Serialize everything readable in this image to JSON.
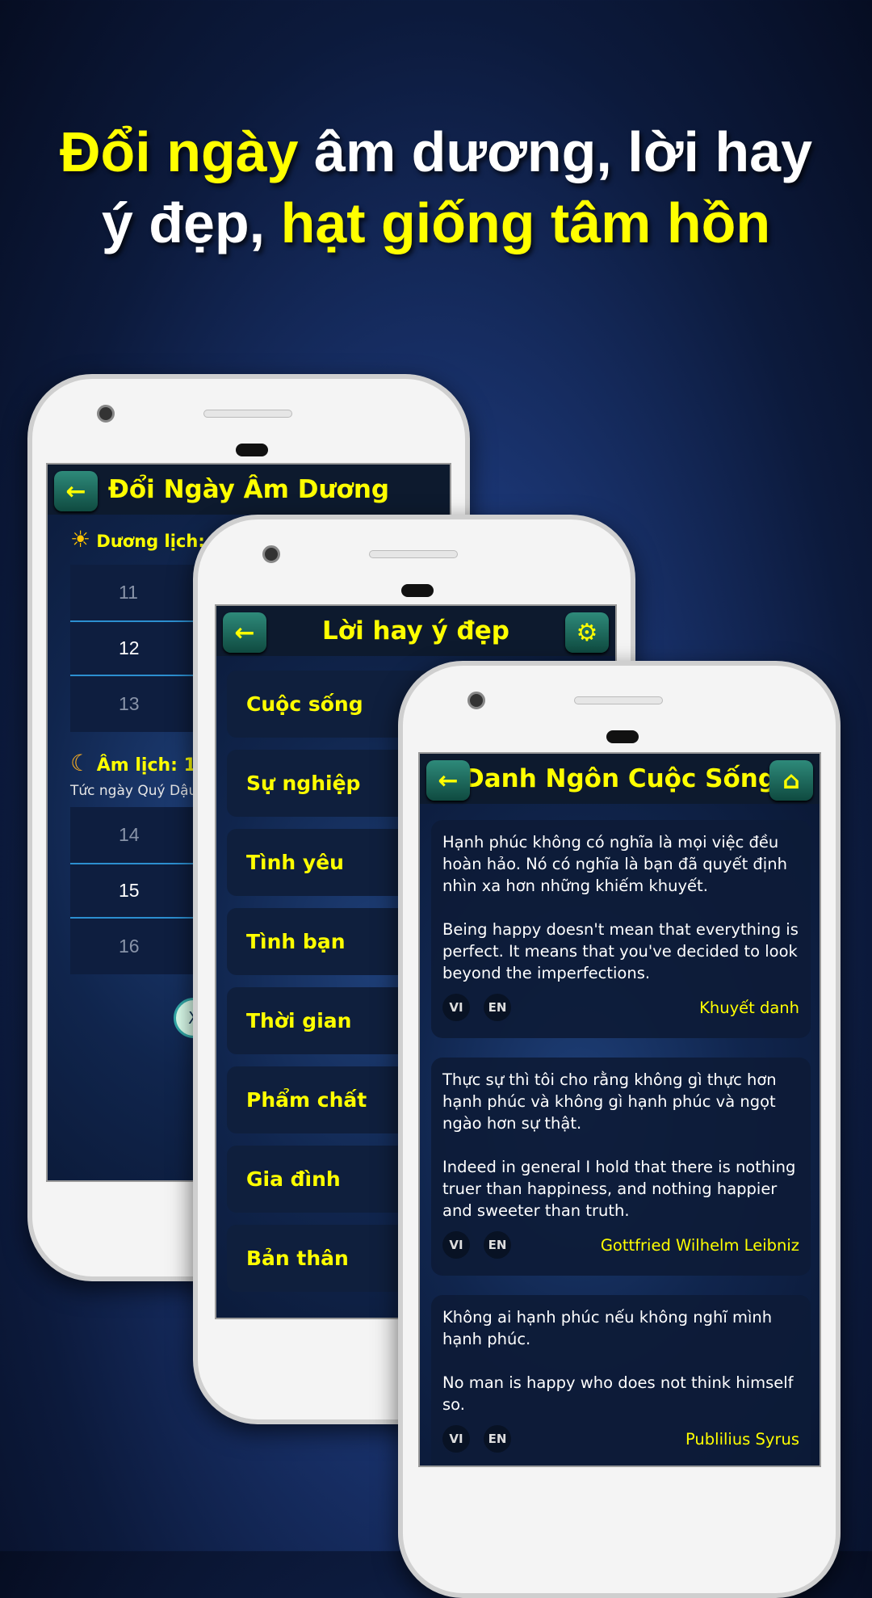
{
  "headline": {
    "line1_a": "Đổi ngày",
    "line1_b": " âm dương, lời hay",
    "line2_a": "ý đẹp, ",
    "line2_b": "hạt giống tâm hồn"
  },
  "colors": {
    "accent": "#ffff00",
    "header_bg": "#0d1a2e",
    "button": "#1f6b5e"
  },
  "phone1": {
    "title": "Đổi Ngày Âm Dương",
    "back_icon": "arrow-left-icon",
    "solar_label": "Dương lịch:",
    "solar_wheel": [
      "11",
      "12",
      "13"
    ],
    "lunar_label": "Âm lịch: 1",
    "lunar_sub": "Tức ngày Quý Dậu",
    "lunar_wheel": [
      "14",
      "15",
      "16"
    ],
    "close_label": "X"
  },
  "phone2": {
    "title": "Lời hay ý đẹp",
    "settings_icon": "gears-icon",
    "categories": [
      "Cuộc sống",
      "Sự nghiệp",
      "Tình yêu",
      "Tình bạn",
      "Thời gian",
      "Phẩm chất",
      "Gia đình",
      "Bản thân"
    ]
  },
  "phone3": {
    "title": "Danh Ngôn Cuộc Sống",
    "home_icon": "home-icon",
    "quotes": [
      {
        "vi": "Hạnh phúc không có nghĩa là mọi việc đều hoàn hảo. Nó có nghĩa là bạn đã quyết định nhìn xa hơn những khiếm khuyết.",
        "en": "Being happy doesn't mean that everything is perfect. It means that you've decided to look beyond the imperfections.",
        "author": "Khuyết danh",
        "vi_btn": "VI",
        "en_btn": "EN"
      },
      {
        "vi": "Thực sự thì tôi cho rằng không gì thực hơn hạnh phúc và không gì hạnh phúc và ngọt ngào hơn sự thật.",
        "en": "Indeed in general I hold that there is nothing truer than happiness, and nothing happier and sweeter than truth.",
        "author": "Gottfried Wilhelm Leibniz",
        "vi_btn": "VI",
        "en_btn": "EN"
      },
      {
        "vi": "Không ai hạnh phúc nếu không nghĩ mình hạnh phúc.",
        "en": "No man is happy who does not think himself so.",
        "author": "Publilius Syrus",
        "vi_btn": "VI",
        "en_btn": "EN"
      }
    ]
  }
}
